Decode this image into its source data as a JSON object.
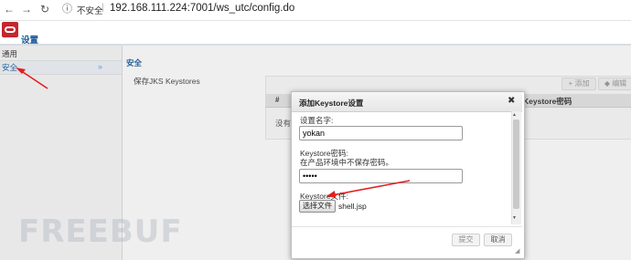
{
  "browser": {
    "back_icon": "←",
    "forward_icon": "→",
    "reload_icon": "↻",
    "info_icon": "ⓘ",
    "insecure_label": "不安全",
    "separator": "|",
    "url": "192.168.111.224:7001/ws_utc/config.do"
  },
  "app": {
    "title": "设置",
    "brand_color": "#c4262e",
    "accent_color": "#1b5a9a"
  },
  "sidebar": {
    "items": [
      {
        "label": "通用"
      },
      {
        "label": "安全",
        "chevron": "»"
      }
    ]
  },
  "content": {
    "section_title": "安全",
    "jks_label": "保存JKS Keystores",
    "toolbar": {
      "add_label": "+ 添加",
      "edit_label": "◆ 编辑"
    },
    "grid": {
      "col_hash": "#",
      "col_password": "Keystore密码"
    },
    "empty_text": "没有项"
  },
  "dialog": {
    "title": "添加Keystore设置",
    "close_icon": "✖",
    "name_label": "设置名字:",
    "name_value": "yokan",
    "password_label": "Keystore密码:",
    "password_hint": "在产品环境中不保存密码。",
    "password_value": "•••••",
    "file_label": "Keystore文件:",
    "choose_file_label": "选择文件",
    "file_name": "shell.jsp",
    "submit_label": "提交",
    "cancel_label": "取消",
    "scroll_up_icon": "▲",
    "scroll_down_icon": "▼",
    "resize_icon": "◢"
  },
  "watermark": "FREEBUF",
  "annotation_color": "#e02020"
}
